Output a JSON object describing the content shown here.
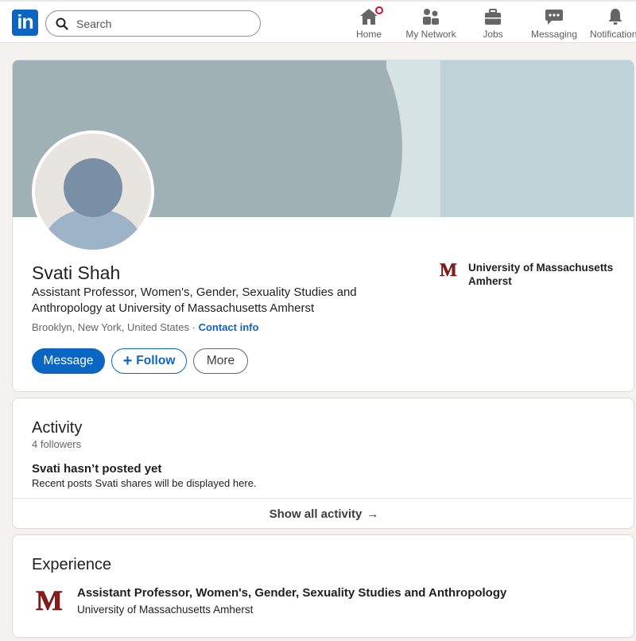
{
  "nav": {
    "logo_text": "in",
    "search_placeholder": "Search",
    "items": [
      {
        "label": "Home",
        "icon": "home-icon"
      },
      {
        "label": "My Network",
        "icon": "people-icon"
      },
      {
        "label": "Jobs",
        "icon": "briefcase-icon"
      },
      {
        "label": "Messaging",
        "icon": "chat-icon"
      },
      {
        "label": "Notifications",
        "icon": "bell-icon"
      }
    ]
  },
  "profile": {
    "name": "Svati Shah",
    "headline": "Assistant Professor, Women's, Gender, Sexuality Studies and Anthropology at University of Massachusetts Amherst",
    "location": "Brooklyn, New York, United States",
    "location_separator": "·",
    "contact_label": "Contact info",
    "education": "University of Massachusetts Amherst",
    "edu_logo_letter": "M",
    "buttons": {
      "message": "Message",
      "follow_plus": "+",
      "follow": "Follow",
      "more": "More"
    }
  },
  "activity": {
    "title": "Activity",
    "followers": "4 followers",
    "empty_title": "Svati hasn’t posted yet",
    "empty_sub": "Recent posts Svati shares will be displayed here.",
    "show_all": "Show all activity",
    "arrow": "→"
  },
  "experience": {
    "title": "Experience",
    "items": [
      {
        "role": "Assistant Professor, Women's, Gender, Sexuality Studies and Anthropology",
        "org": "University of Massachusetts Amherst",
        "logo_letter": "M"
      }
    ]
  },
  "colors": {
    "brand": "#0a66c2",
    "umass_maroon": "#881c1c",
    "notification_badge": "#cb112d"
  }
}
